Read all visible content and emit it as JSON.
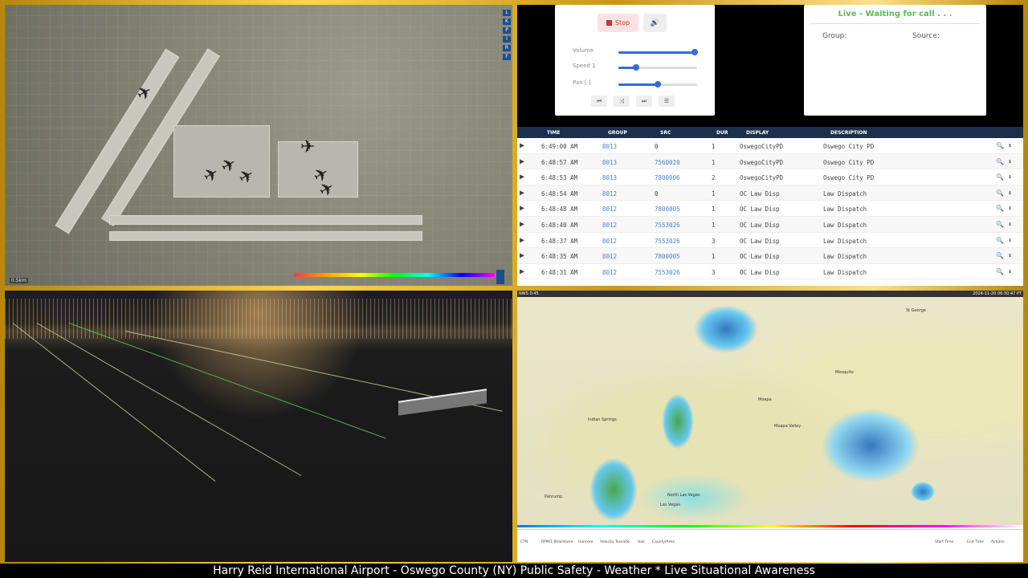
{
  "ticker": "Harry Reid International Airport - Oswego County (NY) Public Safety - Weather * Live Situational Awareness",
  "map": {
    "scale_label": "0.5km",
    "toolbar": [
      "L",
      "K",
      "P",
      "I",
      "R",
      "F"
    ]
  },
  "player": {
    "stop_label": "Stop",
    "volume_label": "Volume",
    "speed_label": "Speed 1",
    "pan_label": "Pan [ ]",
    "volume": 0.97,
    "speed": 0.22,
    "pan": 0.5
  },
  "status": {
    "title": "Live - Waiting for call . . .",
    "group_label": "Group:",
    "source_label": "Source:"
  },
  "calls": {
    "headers": {
      "time": "TIME",
      "group": "GROUP",
      "src": "SRC",
      "dur": "DUR",
      "display": "DISPLAY",
      "description": "DESCRIPTION"
    },
    "rows": [
      {
        "time": "6:49:00 AM",
        "group": "8013",
        "src": "0",
        "dur": "1",
        "display": "OswegoCityPD",
        "description": "Oswego City PD"
      },
      {
        "time": "6:48:57 AM",
        "group": "8013",
        "src": "7560020",
        "dur": "1",
        "display": "OswegoCityPD",
        "description": "Oswego City PD"
      },
      {
        "time": "6:48:53 AM",
        "group": "8013",
        "src": "7800006",
        "dur": "2",
        "display": "OswegoCityPD",
        "description": "Oswego City PD"
      },
      {
        "time": "6:48:54 AM",
        "group": "8012",
        "src": "0",
        "dur": "1",
        "display": "OC Law Disp",
        "description": "Law Dispatch"
      },
      {
        "time": "6:48:48 AM",
        "group": "8012",
        "src": "7800005",
        "dur": "1",
        "display": "OC Law Disp",
        "description": "Law Dispatch"
      },
      {
        "time": "6:48:40 AM",
        "group": "8012",
        "src": "7553026",
        "dur": "1",
        "display": "OC Law Disp",
        "description": "Law Dispatch"
      },
      {
        "time": "6:48:37 AM",
        "group": "8012",
        "src": "7553026",
        "dur": "3",
        "display": "OC Law Disp",
        "description": "Law Dispatch"
      },
      {
        "time": "6:48:35 AM",
        "group": "8012",
        "src": "7800005",
        "dur": "1",
        "display": "OC Law Disp",
        "description": "Law Dispatch"
      },
      {
        "time": "6:48:31 AM",
        "group": "8012",
        "src": "7553026",
        "dur": "3",
        "display": "OC Law Disp",
        "description": "Law Dispatch"
      }
    ]
  },
  "weather": {
    "top_left": "NWS 0:45",
    "top_right": "2024-11-20 06:30:47 PT",
    "cities": [
      {
        "name": "St George"
      },
      {
        "name": "Mesquite"
      },
      {
        "name": "Moapa"
      },
      {
        "name": "Moapa Valley"
      },
      {
        "name": "Indian Springs"
      },
      {
        "name": "North Las Vegas"
      },
      {
        "name": "Las Vegas"
      },
      {
        "name": "Pahrump"
      }
    ],
    "table_headers": [
      "CTN",
      "RPM/1.0",
      "Hailstone",
      "Hailcore",
      "Velocity",
      "Tornado",
      "Hail",
      "County/Area",
      "Start Time",
      "End Time",
      "Actions"
    ]
  }
}
